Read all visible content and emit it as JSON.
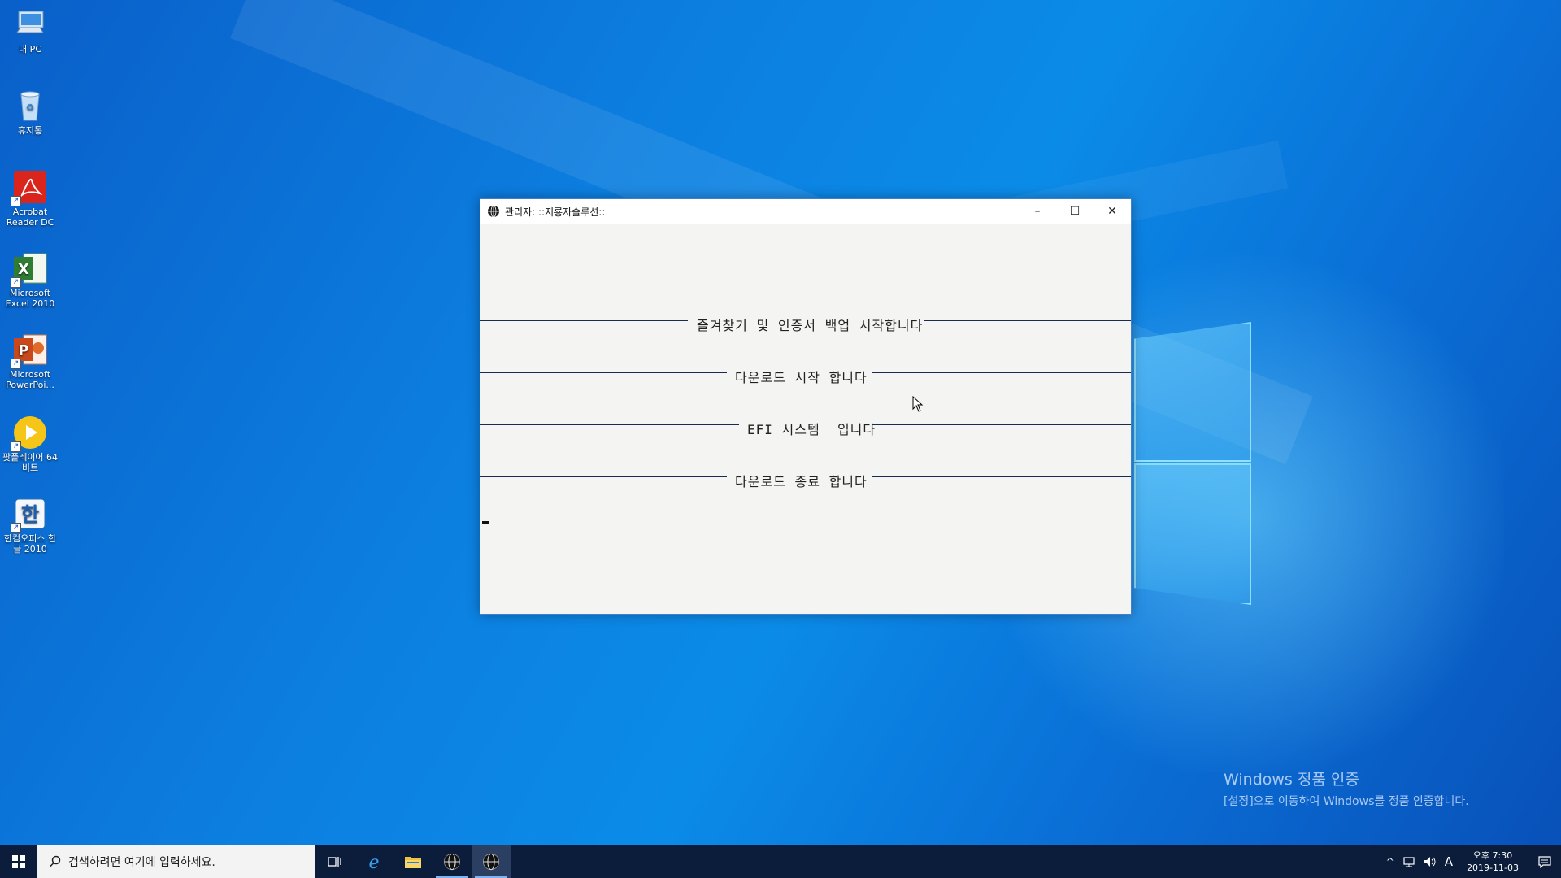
{
  "desktop": {
    "icons": [
      {
        "label": "내 PC",
        "icon": "pc-icon"
      },
      {
        "label": "휴지통",
        "icon": "recycle-bin-icon"
      },
      {
        "label": "Acrobat Reader DC",
        "icon": "acrobat-icon"
      },
      {
        "label": "Microsoft Excel 2010",
        "icon": "excel-icon"
      },
      {
        "label": "Microsoft PowerPoi...",
        "icon": "powerpoint-icon"
      },
      {
        "label": "팟플레이어 64 비트",
        "icon": "potplayer-icon"
      },
      {
        "label": "한컴오피스 한글 2010",
        "icon": "hwp-icon"
      }
    ]
  },
  "window": {
    "title": "관리자:  ::지룡자솔루션::",
    "buttons": {
      "minimize": "–",
      "maximize": "☐",
      "close": "✕"
    },
    "lines": [
      "즐겨찾기 및 인증서 백업 시작합니다",
      "다운로드 시작 합니다",
      "EFI 시스템  입니다",
      "다운로드 종료 합니다"
    ]
  },
  "watermark": {
    "line1": "Windows 정품 인증",
    "line2": "[설정]으로 이동하여 Windows를 정품 인증합니다."
  },
  "taskbar": {
    "search_placeholder": "검색하려면 여기에 입력하세요.",
    "ime": "A",
    "time": "오후 7:30",
    "date": "2019-11-03"
  },
  "colors": {
    "accent": "#0a78e0",
    "taskbar": "#0b1d3a",
    "window_border": "#3f7fd0"
  }
}
